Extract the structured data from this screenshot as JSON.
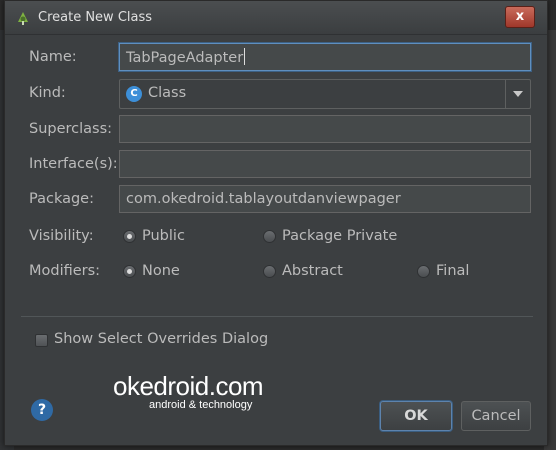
{
  "window": {
    "title": "Create New Class",
    "close_glyph": "x"
  },
  "form": {
    "name": {
      "label": "Name:",
      "value": "TabPageAdapter"
    },
    "kind": {
      "label": "Kind:",
      "value": "Class",
      "icon": "class-icon",
      "icon_letter": "C",
      "icon_color": "#3d8fd8"
    },
    "superclass": {
      "label": "Superclass:",
      "value": ""
    },
    "interfaces": {
      "label": "Interface(s):",
      "value": ""
    },
    "package": {
      "label": "Package:",
      "value": "com.okedroid.tablayoutdanviewpager"
    },
    "visibility": {
      "label": "Visibility:",
      "options": [
        {
          "label": "Public",
          "selected": true
        },
        {
          "label": "Package Private",
          "selected": false
        }
      ]
    },
    "modifiers": {
      "label": "Modifiers:",
      "options": [
        {
          "label": "None",
          "selected": true
        },
        {
          "label": "Abstract",
          "selected": false
        },
        {
          "label": "Final",
          "selected": false
        }
      ]
    },
    "show_overrides": {
      "label": "Show Select Overrides Dialog",
      "checked": false
    }
  },
  "footer": {
    "help_glyph": "?",
    "ok_label": "OK",
    "cancel_label": "Cancel"
  },
  "watermark": {
    "brand": "okedroid.com",
    "tagline": "android & technology"
  },
  "colors": {
    "dialog_bg": "#3c3f41",
    "field_bg": "#45494a",
    "focus_border": "#5f8fbf",
    "close_red": "#a0372a",
    "help_blue": "#2f6aa5"
  }
}
